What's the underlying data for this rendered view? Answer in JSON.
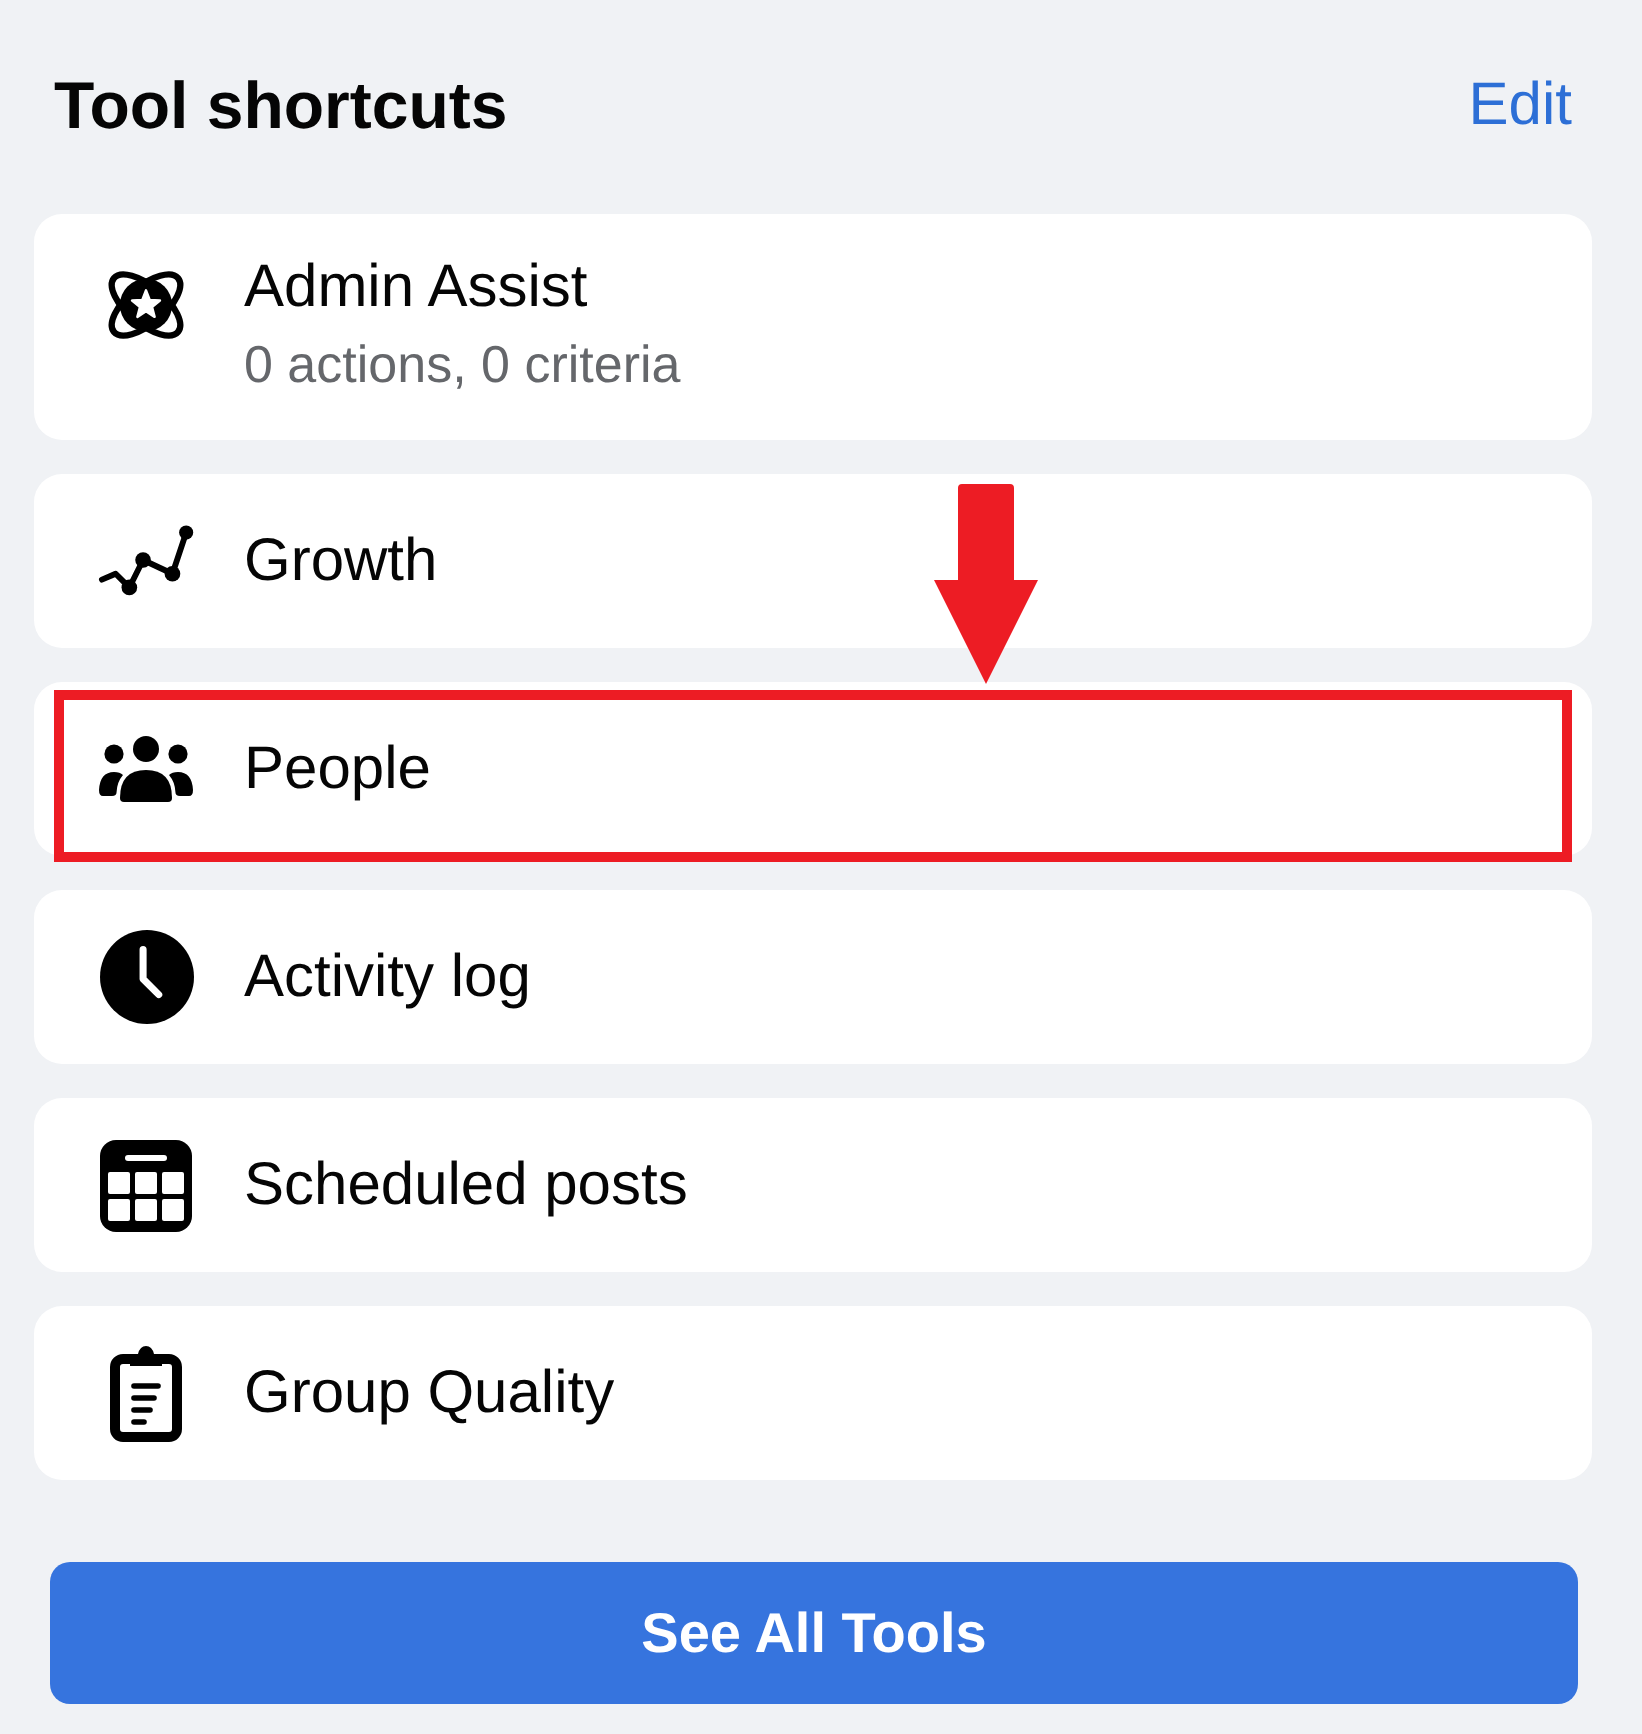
{
  "header": {
    "title": "Tool shortcuts",
    "action": "Edit"
  },
  "shortcuts": [
    {
      "label": "Admin Assist",
      "subtitle": "0 actions, 0 criteria",
      "highlighted": false
    },
    {
      "label": "Growth",
      "highlighted": false
    },
    {
      "label": "People",
      "highlighted": true
    },
    {
      "label": "Activity log",
      "highlighted": false
    },
    {
      "label": "Scheduled posts",
      "highlighted": false
    },
    {
      "label": "Group Quality",
      "highlighted": false
    }
  ],
  "button": {
    "label": "See All Tools"
  }
}
